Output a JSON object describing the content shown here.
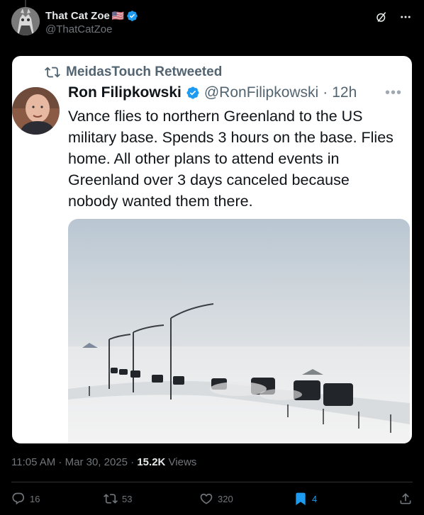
{
  "author": {
    "display_name": "That Cat Zoe",
    "flag": "🇺🇸",
    "handle": "@ThatCatZoe"
  },
  "quoted": {
    "retweet_label": "MeidasTouch Retweeted",
    "name": "Ron Filipkowski",
    "handle": "@RonFilipkowski",
    "separator": "·",
    "time": "12h",
    "text": "Vance flies to northern Greenland to the US military base. Spends 3 hours on the base. Flies home. All other plans to attend events in Greenland over 3 days canceled because nobody wanted them there."
  },
  "meta": {
    "time": "11:05 AM",
    "sep1": " · ",
    "date": "Mar 30, 2025",
    "sep2": " · ",
    "views_count": "15.2K",
    "views_label": " Views"
  },
  "actions": {
    "replies": "16",
    "reposts": "53",
    "likes": "320",
    "bookmarks": "4"
  },
  "colors": {
    "accent": "#1d9bf0",
    "verified": "#1d9bf0"
  },
  "icons": [
    "grok-icon",
    "more-icon",
    "reply-icon",
    "repost-icon",
    "like-icon",
    "bookmark-icon",
    "share-icon"
  ]
}
